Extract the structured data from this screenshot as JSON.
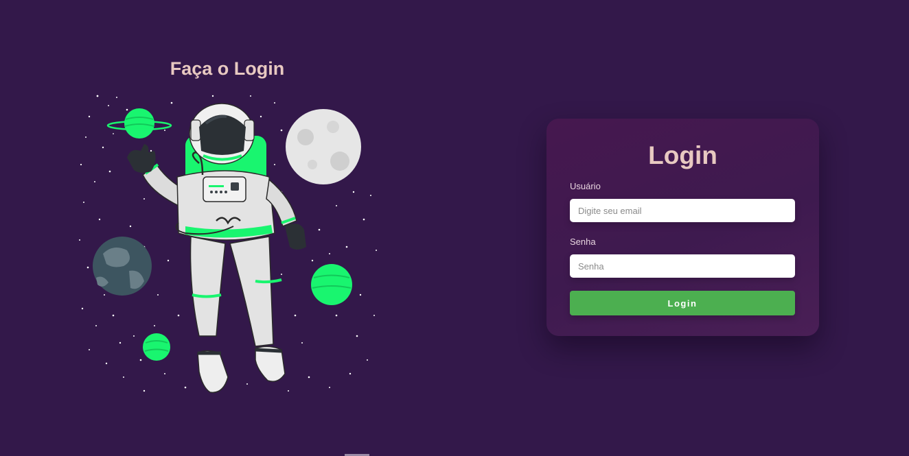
{
  "left": {
    "title": "Faça o Login"
  },
  "card": {
    "title": "Login",
    "username_label": "Usuário",
    "username_placeholder": "Digite seu email",
    "password_label": "Senha",
    "password_placeholder": "Senha",
    "submit_label": "Login"
  },
  "illustration": {
    "icon": "astronaut-illustration",
    "elements": [
      "astronaut",
      "ringed-planet",
      "moon",
      "earth-planet",
      "green-planet",
      "small-green-planet",
      "stars"
    ]
  },
  "colors": {
    "background": "#33184a",
    "card": "#46184f",
    "title": "#e8c9c1",
    "button": "#4caf50",
    "accent": "#19f56f"
  }
}
